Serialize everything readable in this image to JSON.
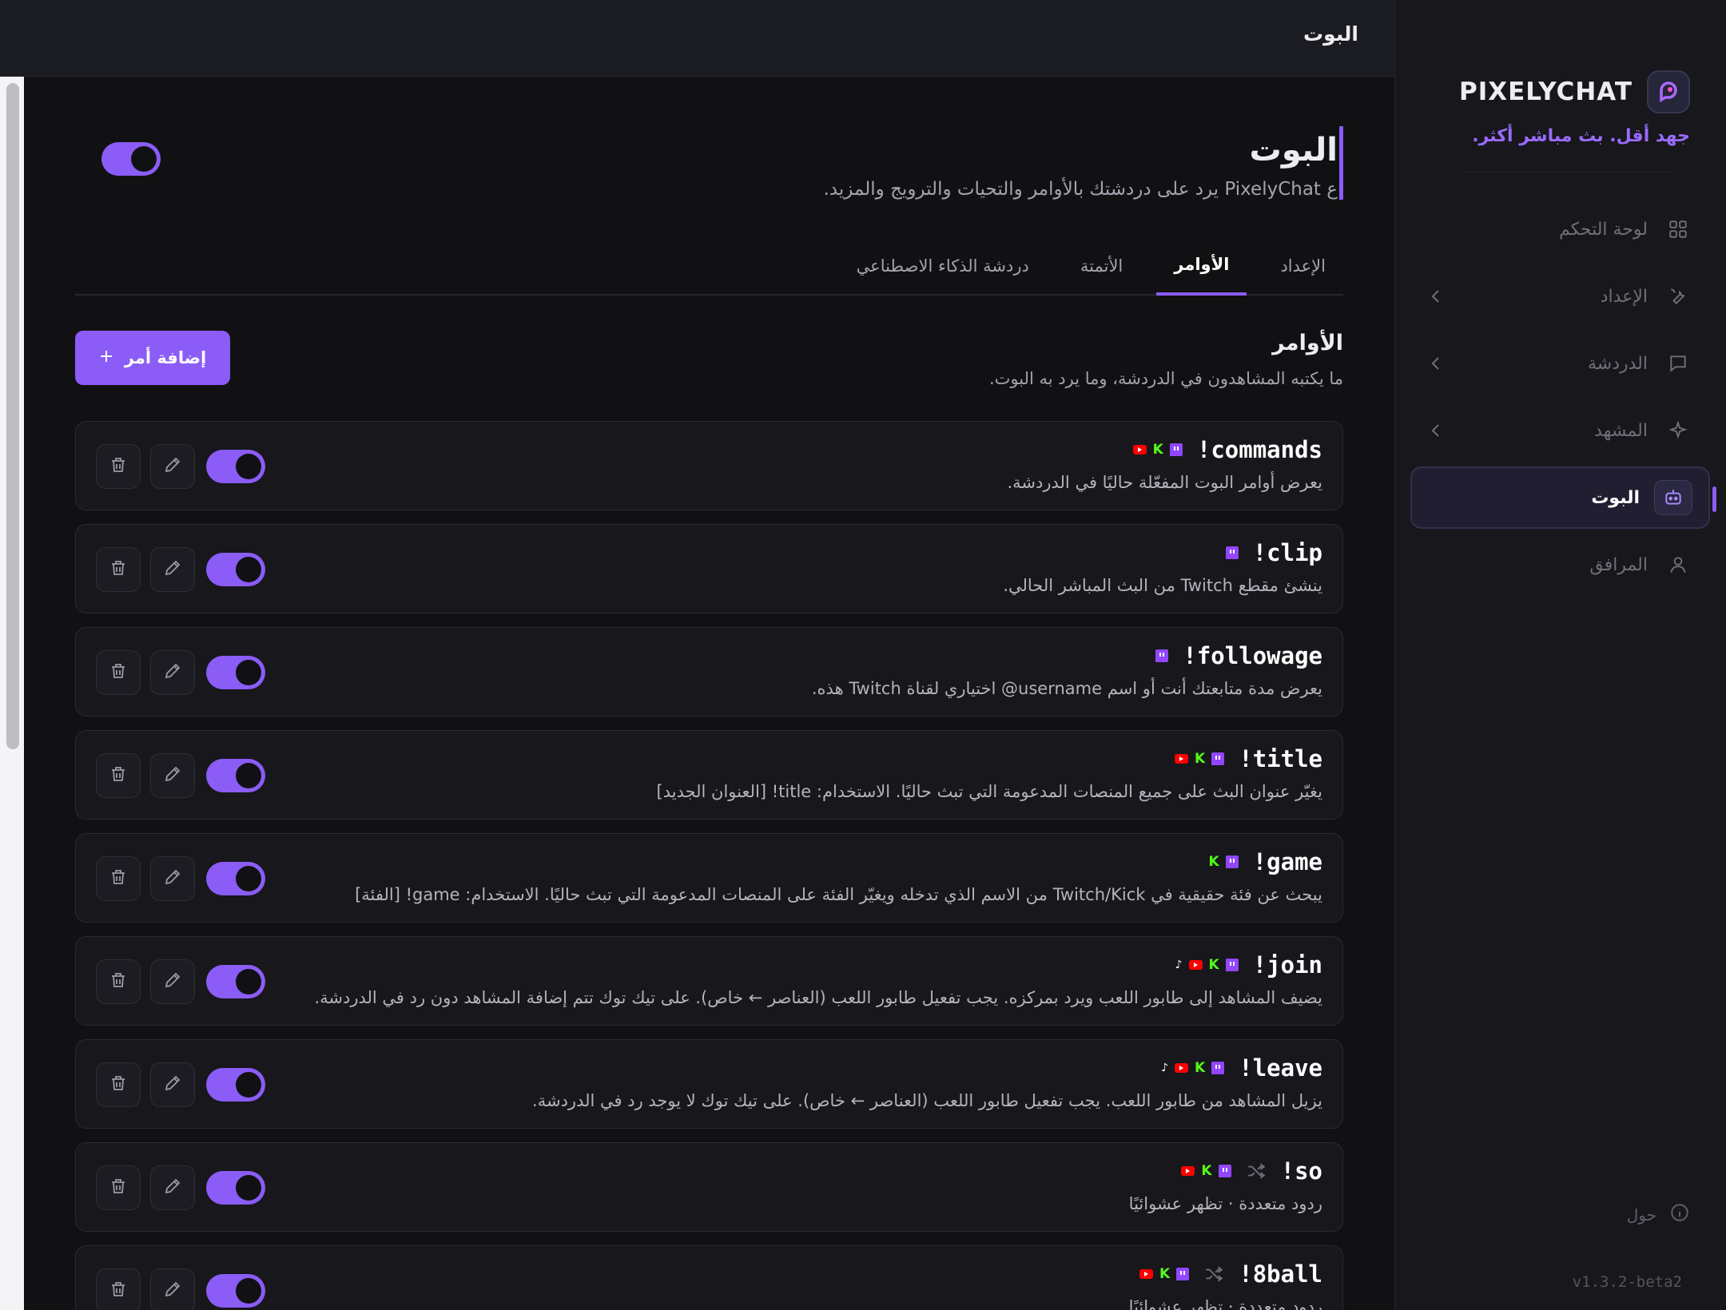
{
  "sidebar": {
    "brand": "PIXELYCHAT",
    "tagline": "جهد أقل. بث مباشر أكثر.",
    "items": [
      {
        "label": "لوحة التحكم"
      },
      {
        "label": "الإعداد"
      },
      {
        "label": "الدردشة"
      },
      {
        "label": "المشهد"
      },
      {
        "label": "البوت"
      },
      {
        "label": "المرافق"
      }
    ],
    "about": "حول",
    "version": "v1.3.2-beta2"
  },
  "topbar": {
    "title": "البوت"
  },
  "page": {
    "title": "البوت",
    "subtitle": "ع PixelyChat يرد على دردشتك بالأوامر والتحيات والترويج والمزيد."
  },
  "tabs": [
    {
      "label": "الإعداد"
    },
    {
      "label": "الأوامر"
    },
    {
      "label": "الأتمتة"
    },
    {
      "label": "دردشة الذكاء الاصطناعي"
    }
  ],
  "section": {
    "title": "الأوامر",
    "subtitle": "ما يكتبه المشاهدون في الدردشة، وما يرد به البوت.",
    "add_label": "إضافة أمر"
  },
  "commands": [
    {
      "name": "!commands",
      "desc": "يعرض أوامر البوت المفعّلة حاليًا في الدردشة.",
      "platforms": [
        "twitch",
        "kick",
        "youtube"
      ],
      "random": false,
      "enabled": true
    },
    {
      "name": "!clip",
      "desc": "ينشئ مقطع Twitch من البث المباشر الحالي.",
      "platforms": [
        "twitch"
      ],
      "random": false,
      "enabled": true
    },
    {
      "name": "!followage",
      "desc": "يعرض مدة متابعتك أنت أو اسم username@ اختياري لقناة Twitch هذه.",
      "platforms": [
        "twitch"
      ],
      "random": false,
      "enabled": true
    },
    {
      "name": "!title",
      "desc": "يغيّر عنوان البث على جميع المنصات المدعومة التي تبث حاليًا. الاستخدام: title! [العنوان الجديد]",
      "platforms": [
        "twitch",
        "kick",
        "youtube"
      ],
      "random": false,
      "enabled": true
    },
    {
      "name": "!game",
      "desc": "يبحث عن فئة حقيقية في Twitch/Kick من الاسم الذي تدخله ويغيّر الفئة على المنصات المدعومة التي تبث حاليًا. الاستخدام: game! [الفئة]",
      "platforms": [
        "twitch",
        "kick"
      ],
      "random": false,
      "enabled": true
    },
    {
      "name": "!join",
      "desc": "يضيف المشاهد إلى طابور اللعب ويرد بمركزه. يجب تفعيل طابور اللعب (العناصر ← خاص). على تيك توك تتم إضافة المشاهد دون رد في الدردشة.",
      "platforms": [
        "twitch",
        "kick",
        "youtube",
        "tiktok"
      ],
      "random": false,
      "enabled": true
    },
    {
      "name": "!leave",
      "desc": "يزيل المشاهد من طابور اللعب. يجب تفعيل طابور اللعب (العناصر ← خاص). على تيك توك لا يوجد رد في الدردشة.",
      "platforms": [
        "twitch",
        "kick",
        "youtube",
        "tiktok"
      ],
      "random": false,
      "enabled": true
    },
    {
      "name": "!so",
      "desc": "ردود متعددة · تظهر عشوائيًا",
      "platforms": [
        "twitch",
        "kick",
        "youtube"
      ],
      "random": true,
      "enabled": true
    },
    {
      "name": "!8ball",
      "desc": "ردود متعددة · تظهر عشوائيًا",
      "platforms": [
        "twitch",
        "kick",
        "youtube"
      ],
      "random": true,
      "enabled": true
    }
  ],
  "colors": {
    "accent": "#8b5cf6",
    "twitch": "#9146ff",
    "kick": "#53fc18",
    "youtube": "#ff0000"
  }
}
